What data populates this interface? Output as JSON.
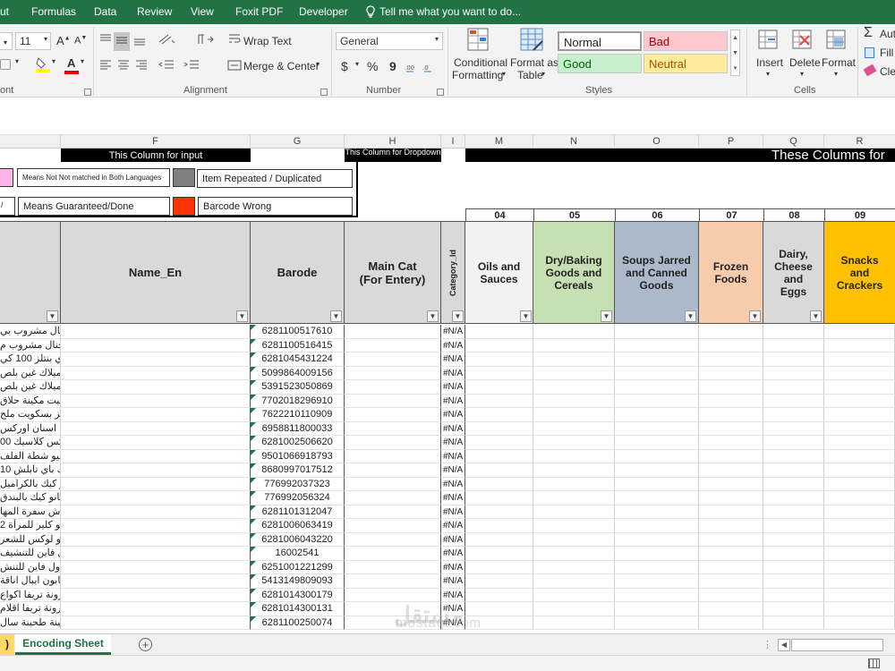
{
  "menu": {
    "items": [
      "ut",
      "Formulas",
      "Data",
      "Review",
      "View",
      "Foxit PDF",
      "Developer"
    ],
    "tell_me": "Tell me what you want to do..."
  },
  "ribbon": {
    "font_size": "11",
    "wrap_text": "Wrap Text",
    "merge_center": "Merge & Center",
    "number_format": "General",
    "currency": "$",
    "percent": "%",
    "comma": "9",
    "conditional_formatting": [
      "Conditional",
      "Formatting"
    ],
    "format_as_table": [
      "Format as",
      "Table"
    ],
    "styles": {
      "normal": "Normal",
      "bad": "Bad",
      "good": "Good",
      "neutral": "Neutral"
    },
    "insert": "Insert",
    "delete": "Delete",
    "format": "Format",
    "autosum": "Aut",
    "fill": "Fill",
    "clear": "Cle",
    "groups": {
      "font": "ont",
      "alignment": "Alignment",
      "number": "Number",
      "styles": "Styles",
      "cells": "Cells"
    }
  },
  "columns": [
    "F",
    "G",
    "H",
    "I",
    "M",
    "N",
    "O",
    "P",
    "Q",
    "R"
  ],
  "banner": {
    "input": "This Column for input",
    "dropdown": "This Column for Dropdown",
    "these_columns": "These Columns for"
  },
  "legend": {
    "not_matched": "Means Not Not matched in Both Languages",
    "repeated": "Item Repeated / Duplicated",
    "guaranteed": "Means Guaranteed/Done",
    "barcode_wrong": "Barcode Wrong"
  },
  "headers": {
    "name_en": "Name_En",
    "barcode": "Barode",
    "main_cat": "Main Cat (For Entery)",
    "category_id": "Category_Id"
  },
  "categories": [
    {
      "num": "04",
      "label": "Oils and Sauces"
    },
    {
      "num": "05",
      "label": "Dry/Baking Goods and Cereals"
    },
    {
      "num": "06",
      "label": "Soups Jarred and Canned Goods"
    },
    {
      "num": "07",
      "label": "Frozen Foods"
    },
    {
      "num": "08",
      "label": "Dairy, Cheese and Eggs"
    },
    {
      "num": "09",
      "label": "Snacks and Crackers"
    }
  ],
  "rows": [
    {
      "ar": "اورجنال مشروب بي",
      "barcode": "6281100517610",
      "cat": "#N/A"
    },
    {
      "ar": "اورجنال مشروب م",
      "barcode": "6281100516415",
      "cat": "#N/A"
    },
    {
      "ar": "شاي بنتلز 100 كي",
      "barcode": "6281045431224",
      "cat": "#N/A"
    },
    {
      "ar": "سيميلاك غين بلص",
      "barcode": "5099864009156",
      "cat": "#N/A"
    },
    {
      "ar": "سيميلاك غين بلص",
      "barcode": "5391523050869",
      "cat": "#N/A"
    },
    {
      "ar": "جيليت مكينة حلاق",
      "barcode": "7702018296910",
      "cat": "#N/A"
    },
    {
      "ar": "ريتز بسكويت ملح",
      "barcode": "7622210110909",
      "cat": "#N/A"
    },
    {
      "ar": "فرشة اسنان اوركس",
      "barcode": "6958811800033",
      "cat": "#N/A"
    },
    {
      "ar": "كلنكس كلاسيك 00",
      "barcode": "6281002506620",
      "cat": "#N/A"
    },
    {
      "ar": "ديليسيو شطة الفلف",
      "barcode": "9501066918793",
      "cat": "#N/A"
    },
    {
      "ar": "بينك باي تابلش 10",
      "barcode": "8680997017512",
      "cat": "#N/A"
    },
    {
      "ar": "فيانو كيك بالكراميل",
      "barcode": "776992037323",
      "cat": "#N/A"
    },
    {
      "ar": "فيانو كيك بالبندق",
      "barcode": "776992056324",
      "cat": "#N/A"
    },
    {
      "ar": "مفارش سفرة المها",
      "barcode": "6281101312047",
      "cat": "#N/A"
    },
    {
      "ar": "شامبو كلير للمرأة 2",
      "barcode": "6281006063419",
      "cat": "#N/A"
    },
    {
      "ar": "شامبو لوكس للشعر",
      "barcode": "6281006043220",
      "cat": "#N/A"
    },
    {
      "ar": "2رول فاين للتنشيف",
      "barcode": "16002541",
      "cat": "#N/A"
    },
    {
      "ar": "10رول فاين للتنش",
      "barcode": "6251001221299",
      "cat": "#N/A"
    },
    {
      "ar": "صابون ايبال اناقة",
      "barcode": "5413149809093",
      "cat": "#N/A"
    },
    {
      "ar": "مكرونة تريفا اكواع",
      "barcode": "6281014300179",
      "cat": "#N/A"
    },
    {
      "ar": "مكرونة تريفا اقلام",
      "barcode": "6281014300131",
      "cat": "#N/A"
    },
    {
      "ar": "طحينة طحينة سال",
      "barcode": "6281100250074",
      "cat": "#N/A"
    }
  ],
  "sheet_tabs": {
    "prev": ")",
    "active": "Encoding Sheet"
  },
  "watermark": {
    "ar": "مستقل",
    "en": "mostaql.com"
  },
  "colors": {
    "excel_green": "#217346",
    "good_bg": "#c6efce",
    "bad_bg": "#ffc7ce",
    "neutral_bg": "#ffeb9c",
    "cat04": "#f2f2f2",
    "cat05": "#c6e0b4",
    "cat06": "#acb9ca",
    "cat07": "#f8cbad",
    "cat08": "#d9d9d9",
    "cat09": "#ffc000",
    "barcode_wrong": "#ff3300",
    "pink": "#ffb3e6",
    "duplicate_gray": "#808080"
  }
}
